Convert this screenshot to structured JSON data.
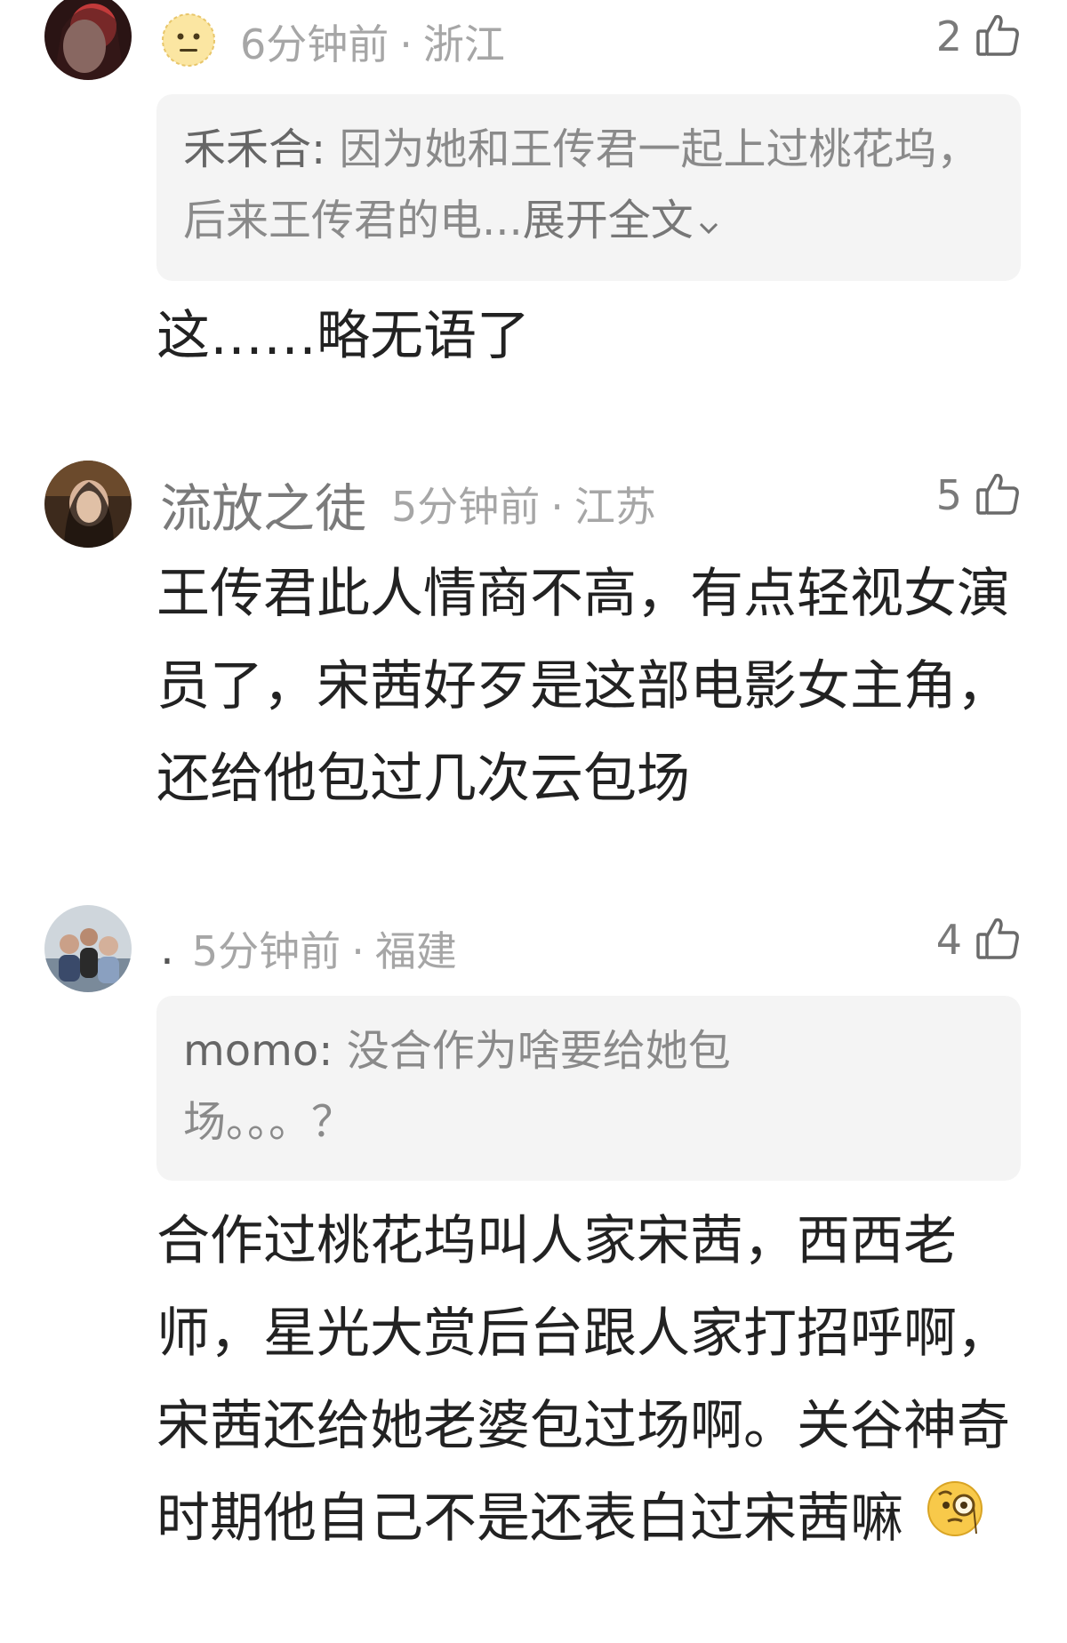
{
  "comments": [
    {
      "username": "",
      "time": "6分钟前",
      "location": "浙江",
      "likes": "2",
      "quote": {
        "author": "禾禾合:",
        "text": "因为她和王传君一起上过桃花坞，后来王传君的电...",
        "expand": "展开全文"
      },
      "text": "这……略无语了"
    },
    {
      "username": "流放之徒",
      "time": "5分钟前",
      "location": "江苏",
      "likes": "5",
      "text": "王传君此人情商不高，有点轻视女演员了，宋茜好歹是这部电影女主角，还给他包过几次云包场"
    },
    {
      "username": ".",
      "time": "5分钟前",
      "location": "福建",
      "likes": "4",
      "quote": {
        "author": "momo:",
        "text": "没合作为啥要给她包场。。。？"
      },
      "text": "合作过桃花坞叫人家宋茜，西西老师，星光大赏后台跟人家打招呼啊，宋茜还给她老婆包过场啊。关谷神奇时期他自己不是还表白过宋茜嘛"
    }
  ],
  "separator": "·",
  "icons": {
    "like": "thumbs-up-icon",
    "chevron": "chevron-down-icon",
    "emoji_username": "expressionless-face-icon",
    "emoji_inline": "monocle-face-icon"
  }
}
